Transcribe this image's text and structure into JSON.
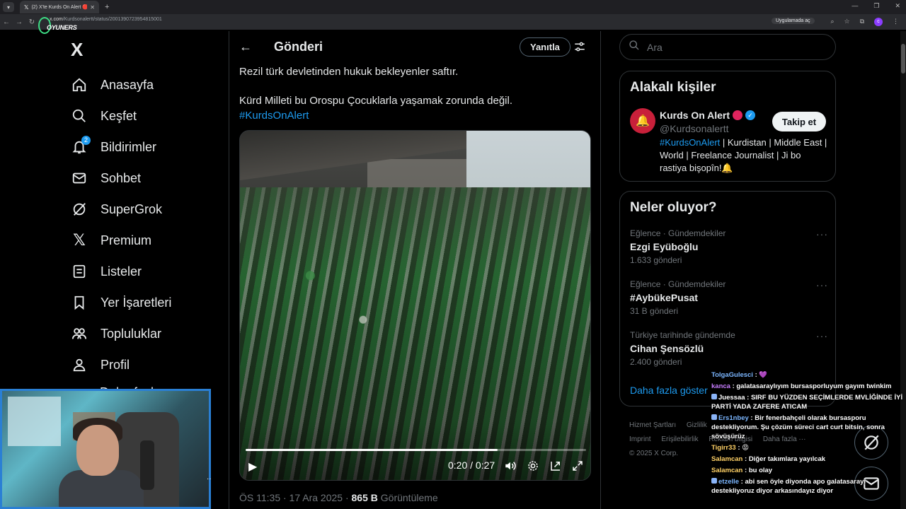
{
  "browser": {
    "tab_title": "(2) X'te Kurds On Alert 🔴 \"He",
    "url_host": "x.com",
    "url_path": "/Kurdsonalertt/status/2001390723954815001",
    "open_in_app": "Uygulamada aç",
    "overlay_logo": "OYUNERS"
  },
  "sidebar": {
    "logo": "X",
    "items": [
      {
        "label": "Anasayfa",
        "icon": "home-icon"
      },
      {
        "label": "Keşfet",
        "icon": "search-icon"
      },
      {
        "label": "Bildirimler",
        "icon": "bell-icon",
        "badge": "2"
      },
      {
        "label": "Sohbet",
        "icon": "mail-icon"
      },
      {
        "label": "SuperGrok",
        "icon": "grok-icon"
      },
      {
        "label": "Premium",
        "icon": "x-icon"
      },
      {
        "label": "Listeler",
        "icon": "list-icon"
      },
      {
        "label": "Yer İşaretleri",
        "icon": "bookmark-icon"
      },
      {
        "label": "Topluluklar",
        "icon": "people-icon"
      },
      {
        "label": "Profil",
        "icon": "person-icon"
      }
    ],
    "partial_item": "Daha fazla"
  },
  "main": {
    "title": "Gönderi",
    "reply_button": "Yanıtla",
    "tweet_line1": "Rezil türk devletinden hukuk bekleyenler saftır.",
    "tweet_line2": "Kürd Milleti bu Orospu Çocuklarla yaşamak zorunda değil.",
    "hashtag": "#KurdsOnAlert",
    "video": {
      "time": "0:20 / 0:27",
      "progress": 0.74
    },
    "meta_time": "ÖS 11:35 · 17 Ara 2025 · ",
    "meta_views": "865 B",
    "meta_views_label": " Görüntüleme"
  },
  "right": {
    "search_placeholder": "Ara",
    "related_title": "Alakalı kişiler",
    "person": {
      "name": "Kurds On Alert",
      "handle": "@Kurdsonalertt",
      "follow": "Takip et",
      "bio_hashtag": "#KurdsOnAlert",
      "bio_rest": " | Kurdistan | Middle East | World | Freelance Journalist | Ji bo rastiya bişopîn!🔔"
    },
    "trends_title": "Neler oluyor?",
    "trends": [
      {
        "category": "Eğlence · Gündemdekiler",
        "name": "Ezgi Eyüboğlu",
        "count": "1.633 gönderi"
      },
      {
        "category": "Eğlence · Gündemdekiler",
        "name": "#AybükePusat",
        "count": "31 B gönderi"
      },
      {
        "category": "Türkiye tarihinde gündemde",
        "name": "Cihan Şensözlü",
        "count": "2.400 gönderi"
      }
    ],
    "show_more": "Daha fazla göster",
    "footer": [
      "Hizmet Şartları",
      "Gizlilik",
      "Erişilebilirlik",
      "Reklam bilgisi",
      "Daha fazla ···",
      "Imprint",
      "© 2025 X Corp."
    ]
  },
  "chat": [
    {
      "user": "TolgaGulesci",
      "color": "#7bb6ff",
      "text": " : 💜"
    },
    {
      "user": "kanca",
      "color": "#c77dff",
      "text": " : galatasaraylıyım bursasporluyum gayım twinkim"
    },
    {
      "user": "Juessaa",
      "color": "#ffffff",
      "text": " : SIRF BU YÜZDEN SEÇİMLERDE MVLİĞİNDE İYİ PARTİ YADA ZAFERE ATICAM"
    },
    {
      "user": "Ers1nbey",
      "color": "#7bb6ff",
      "text": " : Bir fenerbahçeli olarak bursasporu destekliyorum. Şu çözüm süreci cart curt bitsin, sonra sövüşürüz"
    },
    {
      "user": "Tigirr33",
      "color": "#ffd166",
      "text": " : 😡"
    },
    {
      "user": "Salamcan",
      "color": "#ffd166",
      "text": " : Diğer takımlara yayılcak"
    },
    {
      "user": "Salamcan",
      "color": "#ffd166",
      "text": " : bu olay"
    },
    {
      "user": "etzelle",
      "color": "#7bb6ff",
      "text": " : abi sen öyle diyonda apo galatasarayı destekliyoruz diyor arkasındayız diyor"
    }
  ]
}
